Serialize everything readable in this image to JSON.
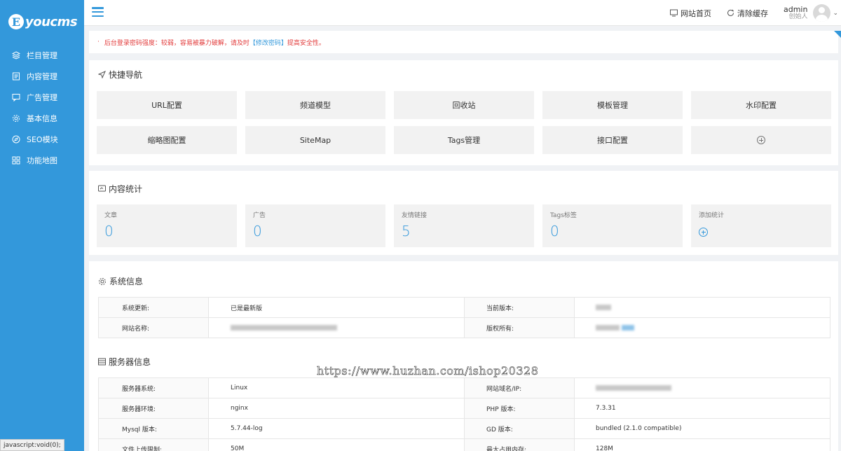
{
  "brand": {
    "logo_letter": "E",
    "logo_text": "youcms",
    "accent_color": "#3398db"
  },
  "sidebar": {
    "items": [
      {
        "icon": "layers-icon",
        "label": "栏目管理"
      },
      {
        "icon": "document-icon",
        "label": "内容管理"
      },
      {
        "icon": "megaphone-icon",
        "label": "广告管理"
      },
      {
        "icon": "gear-icon",
        "label": "基本信息"
      },
      {
        "icon": "compass-icon",
        "label": "SEO模块"
      },
      {
        "icon": "grid-icon",
        "label": "功能地图"
      }
    ]
  },
  "header": {
    "site_home": "网站首页",
    "clear_cache": "清除缓存",
    "user_name": "admin",
    "user_role": "创始人"
  },
  "alert": {
    "text_before": "后台登录密码强度：较弱，容易被暴力破解，请及时",
    "link": "【修改密码】",
    "text_after": "提高安全性。"
  },
  "quick_nav": {
    "title": "快捷导航",
    "buttons": [
      "URL配置",
      "频道模型",
      "回收站",
      "模板管理",
      "水印配置",
      "缩略图配置",
      "SiteMap",
      "Tags管理",
      "接口配置"
    ]
  },
  "content_stats": {
    "title": "内容统计",
    "items": [
      {
        "label": "文章",
        "value": "0"
      },
      {
        "label": "广告",
        "value": "0"
      },
      {
        "label": "友情链接",
        "value": "5"
      },
      {
        "label": "Tags标签",
        "value": "0"
      }
    ],
    "add_label": "添加统计"
  },
  "system_info": {
    "title": "系统信息",
    "rows": [
      {
        "k1": "系统更新:",
        "v1": "已是最新版",
        "k2": "当前版本:"
      },
      {
        "k1": "网站名称:",
        "k2": "版权所有:"
      }
    ]
  },
  "server_info": {
    "title": "服务器信息",
    "rows": [
      {
        "k1": "服务器系统:",
        "v1": "Linux",
        "k2": "网站域名/IP:",
        "v2": ""
      },
      {
        "k1": "服务器环境:",
        "v1": "nginx",
        "k2": "PHP 版本:",
        "v2": "7.3.31"
      },
      {
        "k1": "Mysql 版本:",
        "v1": "5.7.44-log",
        "k2": "GD 版本:",
        "v2": "bundled (2.1.0 compatible)"
      },
      {
        "k1": "文件上传限制:",
        "v1": "50M",
        "k2": "最大占用内存:",
        "v2": "128M"
      }
    ]
  },
  "watermark": "https://www.huzhan.com/ishop20328",
  "statusbar": "javascript:void(0);"
}
